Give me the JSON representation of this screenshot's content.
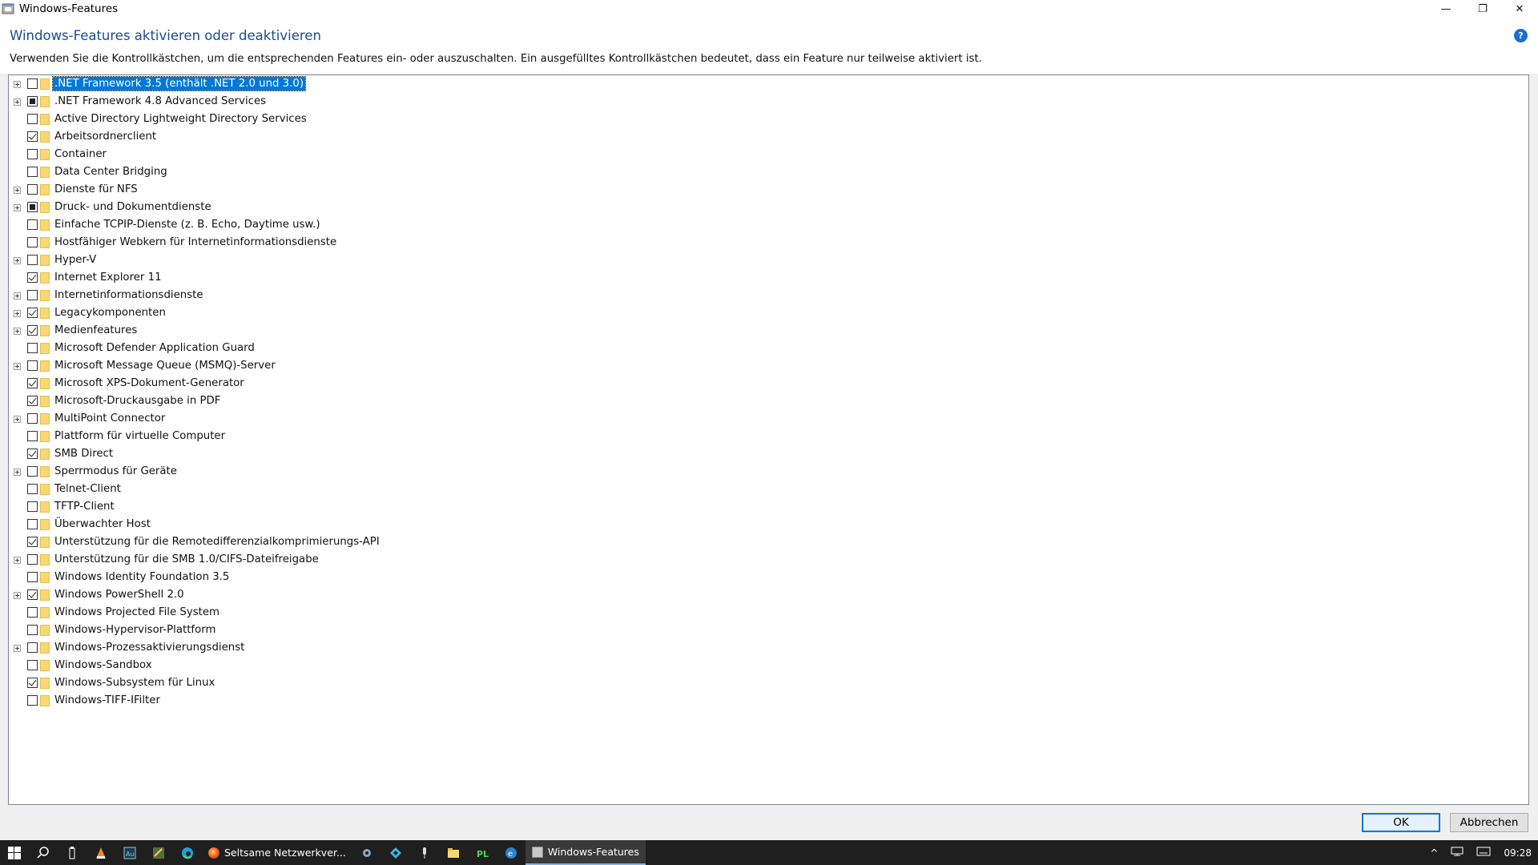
{
  "window": {
    "title": "Windows-Features",
    "heading": "Windows-Features aktivieren oder deaktivieren",
    "description": "Verwenden Sie die Kontrollkästchen, um die entsprechenden Features ein- oder auszuschalten. Ein ausgefülltes Kontrollkästchen bedeutet, dass ein Feature nur teilweise aktiviert ist.",
    "help_glyph": "?",
    "minimize_glyph": "—",
    "restore_glyph": "❐",
    "close_glyph": "✕"
  },
  "features": [
    {
      "label": ".NET Framework 3.5 (enthält .NET 2.0 und 3.0)",
      "state": "unchecked",
      "expandable": true,
      "selected": true
    },
    {
      "label": ".NET Framework 4.8 Advanced Services",
      "state": "partial",
      "expandable": true
    },
    {
      "label": "Active Directory Lightweight Directory Services",
      "state": "unchecked",
      "expandable": false
    },
    {
      "label": "Arbeitsordnerclient",
      "state": "checked",
      "expandable": false
    },
    {
      "label": "Container",
      "state": "unchecked",
      "expandable": false
    },
    {
      "label": "Data Center Bridging",
      "state": "unchecked",
      "expandable": false
    },
    {
      "label": "Dienste für NFS",
      "state": "unchecked",
      "expandable": true
    },
    {
      "label": "Druck- und Dokumentdienste",
      "state": "partial",
      "expandable": true
    },
    {
      "label": "Einfache TCPIP-Dienste (z. B. Echo, Daytime usw.)",
      "state": "unchecked",
      "expandable": false
    },
    {
      "label": "Hostfähiger Webkern für Internetinformationsdienste",
      "state": "unchecked",
      "expandable": false
    },
    {
      "label": "Hyper-V",
      "state": "unchecked",
      "expandable": true
    },
    {
      "label": "Internet Explorer 11",
      "state": "checked",
      "expandable": false
    },
    {
      "label": "Internetinformationsdienste",
      "state": "unchecked",
      "expandable": true
    },
    {
      "label": "Legacykomponenten",
      "state": "checked",
      "expandable": true
    },
    {
      "label": "Medienfeatures",
      "state": "checked",
      "expandable": true
    },
    {
      "label": "Microsoft Defender Application Guard",
      "state": "unchecked",
      "expandable": false
    },
    {
      "label": "Microsoft Message Queue (MSMQ)-Server",
      "state": "unchecked",
      "expandable": true
    },
    {
      "label": "Microsoft XPS-Dokument-Generator",
      "state": "checked",
      "expandable": false
    },
    {
      "label": "Microsoft-Druckausgabe in PDF",
      "state": "checked",
      "expandable": false
    },
    {
      "label": "MultiPoint Connector",
      "state": "unchecked",
      "expandable": true
    },
    {
      "label": "Plattform für virtuelle Computer",
      "state": "unchecked",
      "expandable": false
    },
    {
      "label": "SMB Direct",
      "state": "checked",
      "expandable": false
    },
    {
      "label": "Sperrmodus für Geräte",
      "state": "unchecked",
      "expandable": true
    },
    {
      "label": "Telnet-Client",
      "state": "unchecked",
      "expandable": false
    },
    {
      "label": "TFTP-Client",
      "state": "unchecked",
      "expandable": false
    },
    {
      "label": "Überwachter Host",
      "state": "unchecked",
      "expandable": false
    },
    {
      "label": "Unterstützung für die Remotedifferenzialkomprimierungs-API",
      "state": "checked",
      "expandable": false
    },
    {
      "label": "Unterstützung für die SMB 1.0/CIFS-Dateifreigabe",
      "state": "unchecked",
      "expandable": true
    },
    {
      "label": "Windows Identity Foundation 3.5",
      "state": "unchecked",
      "expandable": false
    },
    {
      "label": "Windows PowerShell 2.0",
      "state": "checked",
      "expandable": true
    },
    {
      "label": "Windows Projected File System",
      "state": "unchecked",
      "expandable": false
    },
    {
      "label": "Windows-Hypervisor-Plattform",
      "state": "unchecked",
      "expandable": false
    },
    {
      "label": "Windows-Prozessaktivierungsdienst",
      "state": "unchecked",
      "expandable": true
    },
    {
      "label": "Windows-Sandbox",
      "state": "unchecked",
      "expandable": false
    },
    {
      "label": "Windows-Subsystem für Linux",
      "state": "checked",
      "expandable": false
    },
    {
      "label": "Windows-TIFF-IFilter",
      "state": "unchecked",
      "expandable": false
    }
  ],
  "buttons": {
    "ok": "OK",
    "cancel": "Abbrechen"
  },
  "taskbar": {
    "firefox_window": "Seltsame Netzwerkver...",
    "features_window": "Windows-Features",
    "clock": "09:28",
    "tray_chevron": "^"
  },
  "colors": {
    "accent": "#0078d7",
    "heading": "#1c4b90",
    "folder": "#f8d775"
  }
}
